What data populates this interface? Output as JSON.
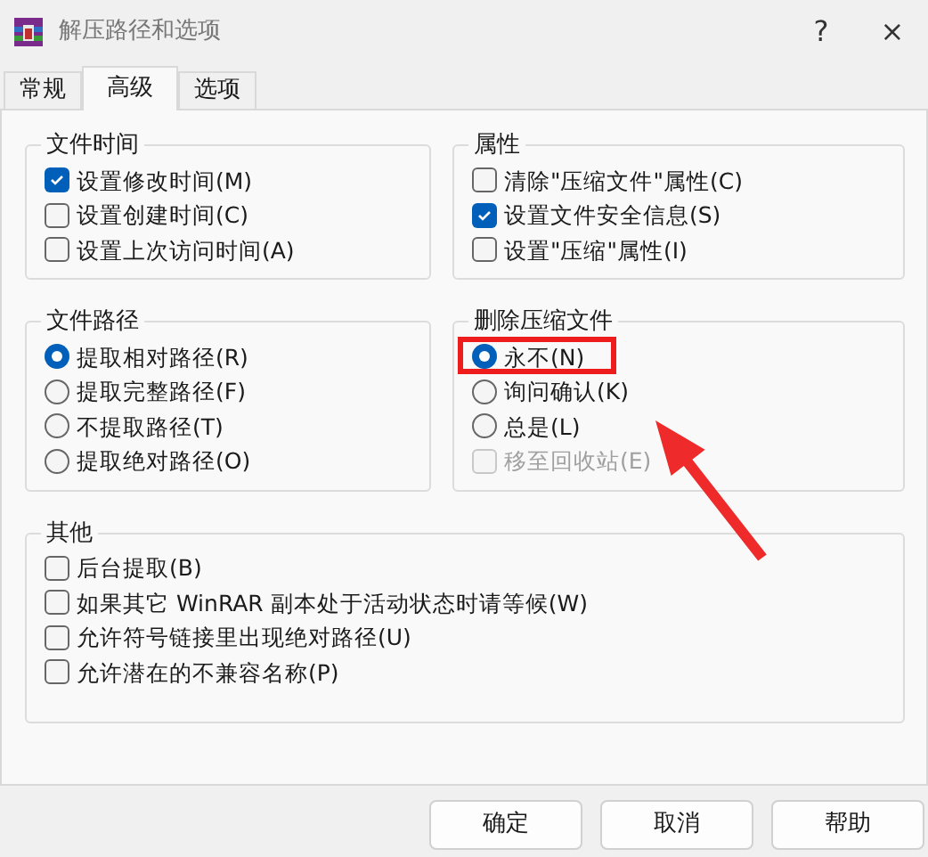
{
  "window": {
    "title": "解压路径和选项",
    "controls": [
      "?",
      "×"
    ]
  },
  "tabs": [
    {
      "label": "常规",
      "selected": false
    },
    {
      "label": "高级",
      "selected": true
    },
    {
      "label": "选项",
      "selected": false
    }
  ],
  "groups": [
    {
      "title": "文件时间",
      "items": [
        {
          "kind": "checkbox",
          "label": "设置修改时间(M)",
          "checked": true,
          "disabled": false
        },
        {
          "kind": "checkbox",
          "label": "设置创建时间(C)",
          "checked": false,
          "disabled": false
        },
        {
          "kind": "checkbox",
          "label": "设置上次访问时间(A)",
          "checked": false,
          "disabled": false
        }
      ]
    },
    {
      "title": "属性",
      "items": [
        {
          "kind": "checkbox",
          "label": "清除\"压缩文件\"属性(C)",
          "checked": false,
          "disabled": false
        },
        {
          "kind": "checkbox",
          "label": "设置文件安全信息(S)",
          "checked": true,
          "disabled": false
        },
        {
          "kind": "checkbox",
          "label": "设置\"压缩\"属性(I)",
          "checked": false,
          "disabled": false
        }
      ]
    },
    {
      "title": "文件路径",
      "items": [
        {
          "kind": "radio",
          "label": "提取相对路径(R)",
          "selected": true,
          "disabled": false
        },
        {
          "kind": "radio",
          "label": "提取完整路径(F)",
          "selected": false,
          "disabled": false
        },
        {
          "kind": "radio",
          "label": "不提取路径(T)",
          "selected": false,
          "disabled": false
        },
        {
          "kind": "radio",
          "label": "提取绝对路径(O)",
          "selected": false,
          "disabled": false
        }
      ]
    },
    {
      "title": "删除压缩文件",
      "items": [
        {
          "kind": "radio",
          "label": "永不(N)",
          "selected": true,
          "disabled": false
        },
        {
          "kind": "radio",
          "label": "询问确认(K)",
          "selected": false,
          "disabled": false
        },
        {
          "kind": "radio",
          "label": "总是(L)",
          "selected": false,
          "disabled": false
        },
        {
          "kind": "checkbox",
          "label": "移至回收站(E)",
          "checked": false,
          "disabled": true
        }
      ]
    },
    {
      "title": "其他",
      "items": [
        {
          "kind": "checkbox",
          "label": "后台提取(B)",
          "checked": false,
          "disabled": false
        },
        {
          "kind": "checkbox",
          "label": "如果其它 WinRAR 副本处于活动状态时请等候(W)",
          "checked": false,
          "disabled": false
        },
        {
          "kind": "checkbox",
          "label": "允许符号链接里出现绝对路径(U)",
          "checked": false,
          "disabled": false
        },
        {
          "kind": "checkbox",
          "label": "允许潜在的不兼容名称(P)",
          "checked": false,
          "disabled": false
        }
      ]
    }
  ],
  "buttons": [
    "确定",
    "取消",
    "帮助"
  ]
}
